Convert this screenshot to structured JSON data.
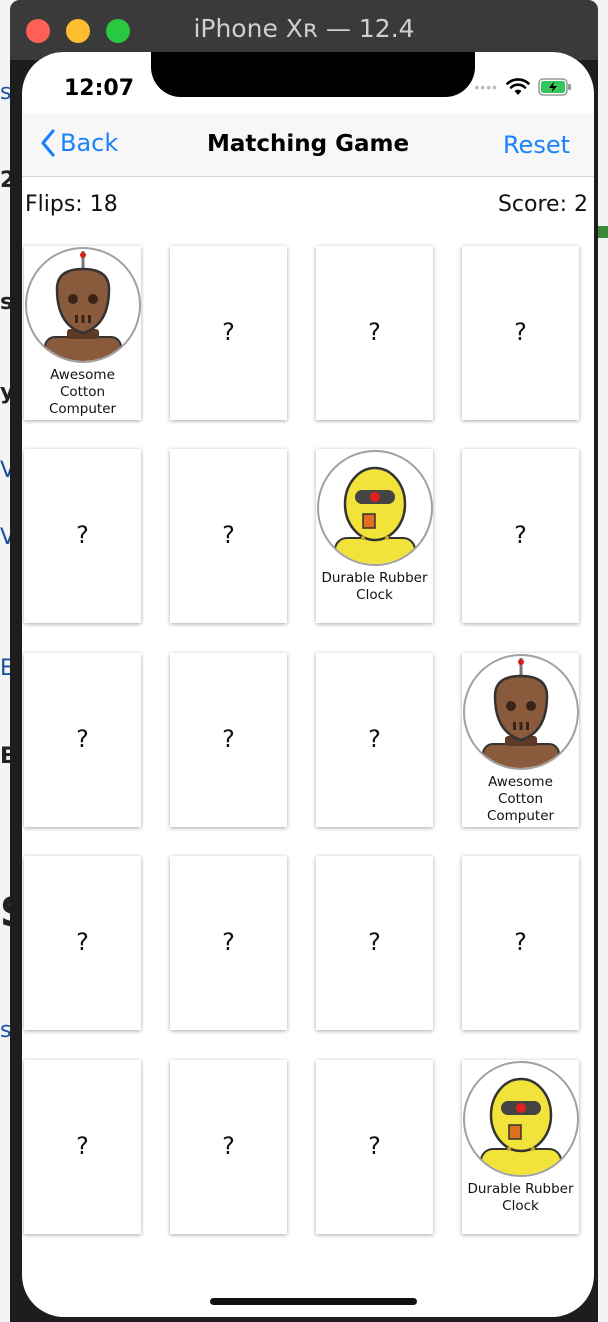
{
  "simulator": {
    "title": "iPhone Xʀ — 12.4"
  },
  "status_bar": {
    "time": "12:07"
  },
  "navbar": {
    "back_label": "Back",
    "title": "Matching Game",
    "reset_label": "Reset"
  },
  "stats": {
    "flips": "Flips: 18",
    "score": "Score: 2"
  },
  "card_placeholder": "?",
  "cards": [
    {
      "face_up": true,
      "robot": "brown",
      "label": "Awesome Cotton Computer"
    },
    {
      "face_up": false
    },
    {
      "face_up": false
    },
    {
      "face_up": false
    },
    {
      "face_up": false
    },
    {
      "face_up": false
    },
    {
      "face_up": true,
      "robot": "yellow",
      "label": "Durable Rubber Clock"
    },
    {
      "face_up": false
    },
    {
      "face_up": false
    },
    {
      "face_up": false
    },
    {
      "face_up": false
    },
    {
      "face_up": true,
      "robot": "brown",
      "label": "Awesome Cotton Computer"
    },
    {
      "face_up": false
    },
    {
      "face_up": false
    },
    {
      "face_up": false
    },
    {
      "face_up": false
    },
    {
      "face_up": false
    },
    {
      "face_up": false
    },
    {
      "face_up": false
    },
    {
      "face_up": true,
      "robot": "yellow",
      "label": "Durable Rubber Clock"
    }
  ],
  "colors": {
    "accent": "#1a82fb",
    "robot_brown": "#8a5a3c",
    "robot_yellow": "#f2e33a"
  }
}
